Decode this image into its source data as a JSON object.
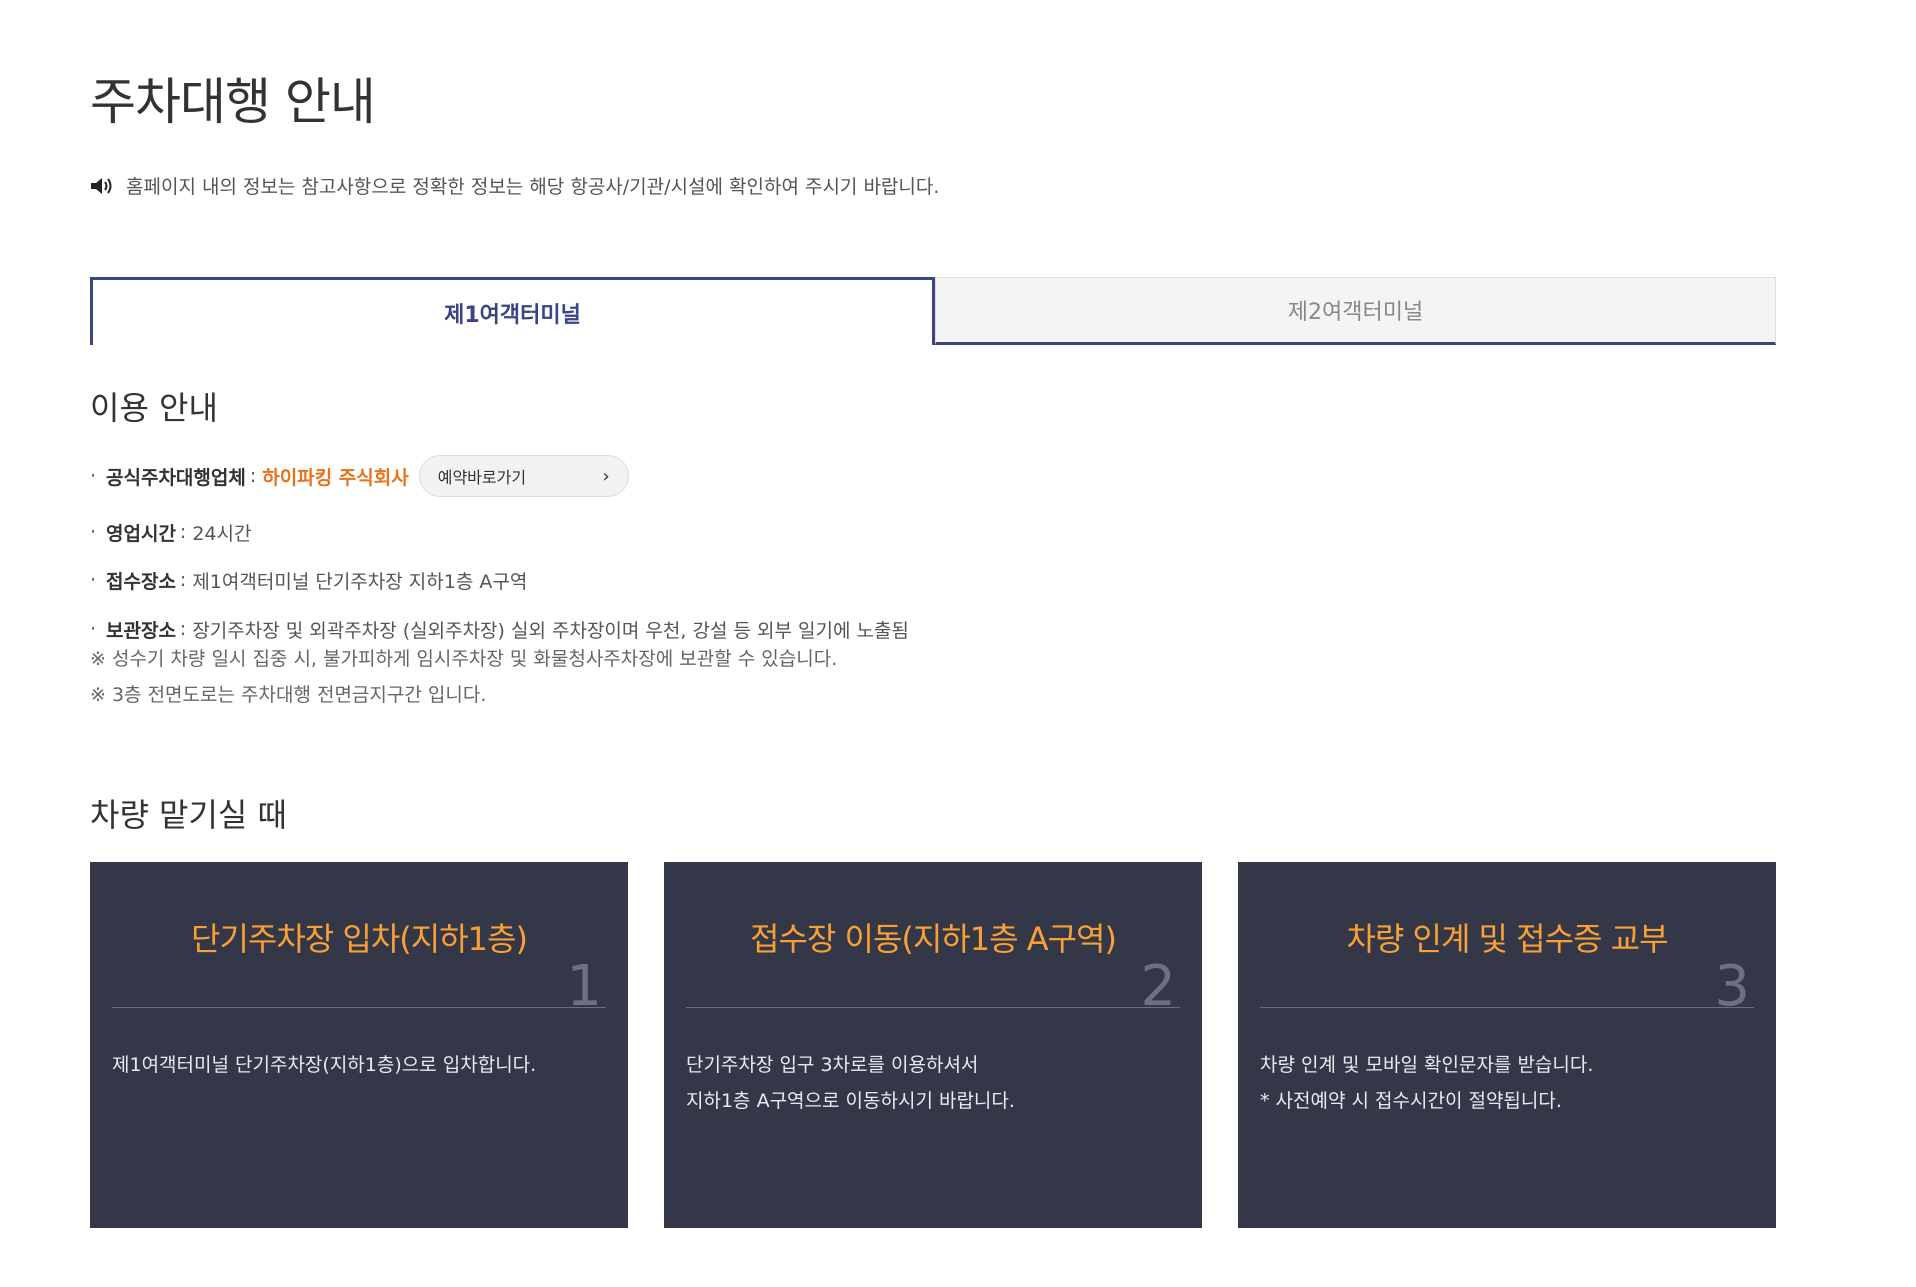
{
  "page": {
    "title": "주차대행 안내",
    "notice": "홈페이지 내의 정보는 참고사항으로 정확한 정보는 해당 항공사/기관/시설에 확인하여 주시기 바랍니다."
  },
  "tabs": [
    {
      "label": "제1여객터미널",
      "active": true
    },
    {
      "label": "제2여객터미널",
      "active": false
    }
  ],
  "usage": {
    "heading": "이용 안내",
    "operator_label": "공식주차대행업체",
    "operator_name": "하이파킹 주식회사",
    "reserve_button": "예약바로가기",
    "hours_label": "영업시간",
    "hours_value": "24시간",
    "reception_label": "접수장소",
    "reception_value": "제1여객터미널 단기주차장 지하1층 A구역",
    "storage_label": "보관장소",
    "storage_value": "장기주차장 및 외곽주차장 (실외주차장) 실외 주차장이며 우천, 강설 등 외부 일기에 노출됨",
    "note1": "※ 성수기 차량 일시 집중 시, 불가피하게 임시주차장 및 화물청사주차장에 보관할 수 있습니다.",
    "note2": "※ 3층 전면도로는 주차대행 전면금지구간 입니다."
  },
  "dropoff": {
    "heading": "차량 맡기실 때",
    "steps": [
      {
        "title": "단기주차장 입차(지하1층)",
        "number": "1",
        "lines": [
          "제1여객터미널 단기주차장(지하1층)으로 입차합니다."
        ]
      },
      {
        "title": "접수장 이동(지하1층 A구역)",
        "number": "2",
        "lines": [
          "단기주차장 입구 3차로를 이용하셔서",
          "지하1층 A구역으로 이동하시기 바랍니다."
        ]
      },
      {
        "title": "차량 인계 및 접수증 교부",
        "number": "3",
        "lines": [
          "차량 인계 및 모바일 확인문자를 받습니다.",
          "* 사전예약 시 접수시간이 절약됩니다."
        ]
      }
    ]
  },
  "colors": {
    "accent": "#3b4485",
    "company": "#e8731a",
    "card_bg": "#343747",
    "card_title": "#f7a035"
  },
  "icons": {
    "notice": "speaker-icon",
    "reserve": "chevron-right-icon"
  }
}
